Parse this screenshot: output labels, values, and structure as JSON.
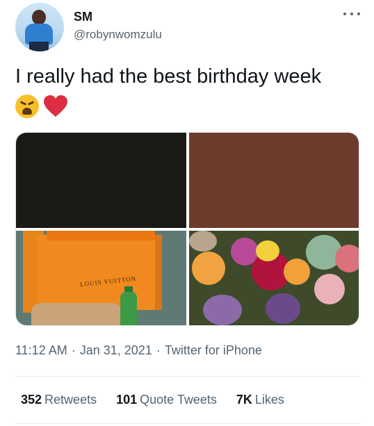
{
  "header": {
    "display_name": "SM",
    "handle": "@robynwomzulu",
    "more_icon": "more-horizontal-icon"
  },
  "tweet": {
    "text": "I really had the best birthday week",
    "emojis": [
      "weary-face-emoji",
      "red-heart-emoji"
    ]
  },
  "media": {
    "bag_label": "LOUIS VUITTON",
    "tile_colors": [
      "#1a1a17",
      "#6c3b2c"
    ]
  },
  "meta": {
    "time": "11:12 AM",
    "separator": "·",
    "date": "Jan 31, 2021",
    "source": "Twitter for iPhone"
  },
  "stats": {
    "retweets_count": "352",
    "retweets_label": "Retweets",
    "quotes_count": "101",
    "quotes_label": "Quote Tweets",
    "likes_count": "7K",
    "likes_label": "Likes"
  }
}
